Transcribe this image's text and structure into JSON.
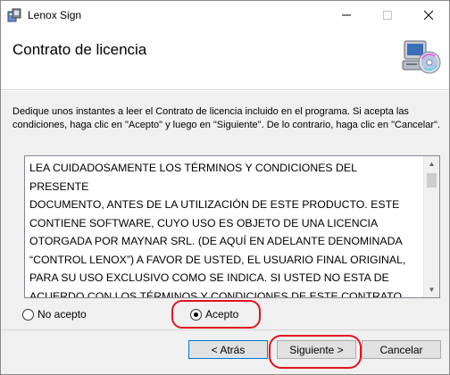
{
  "window": {
    "title": "Lenox Sign"
  },
  "header": {
    "title": "Contrato de licencia"
  },
  "instructions": "Dedique unos instantes a leer el Contrato de licencia incluido en el programa. Si acepta las condiciones, haga clic en \"Acepto\" y luego en \"Siguiente\". De lo contrario, haga clic en \"Cancelar\".",
  "license": {
    "text": "LEA CUIDADOSAMENTE LOS TÉRMINOS Y CONDICIONES DEL PRESENTE\nDOCUMENTO, ANTES DE LA UTILIZACIÓN DE ESTE PRODUCTO. ESTE\nCONTIENE SOFTWARE, CUYO USO ES OBJETO DE UNA LICENCIA\nOTORGADA POR MAYNAR SRL. (DE AQUÍ EN ADELANTE DENOMINADA\n“CONTROL LENOX”) A FAVOR DE USTED, EL USUARIO FINAL ORIGINAL,\nPARA SU USO EXCLUSIVO COMO SE INDICA. SI USTED NO ESTA DE\nACUERDO CON LOS TÉRMINOS Y CONDICIONES DE ESTE CONTRATO, NO\nUTILICE EL SOFTWARE. EL USO DE CUALQUIER PARTE DEL SOFTWARE"
  },
  "options": {
    "decline_label": "No acepto",
    "accept_label": "Acepto",
    "selected": "accept"
  },
  "buttons": {
    "back": "< Atrás",
    "next": "Siguiente >",
    "cancel": "Cancelar"
  },
  "icons": {
    "app": "installer-icon",
    "header": "computer-disc-icon"
  },
  "colors": {
    "highlight": "#e0141e",
    "focus_border": "#0078d7"
  }
}
